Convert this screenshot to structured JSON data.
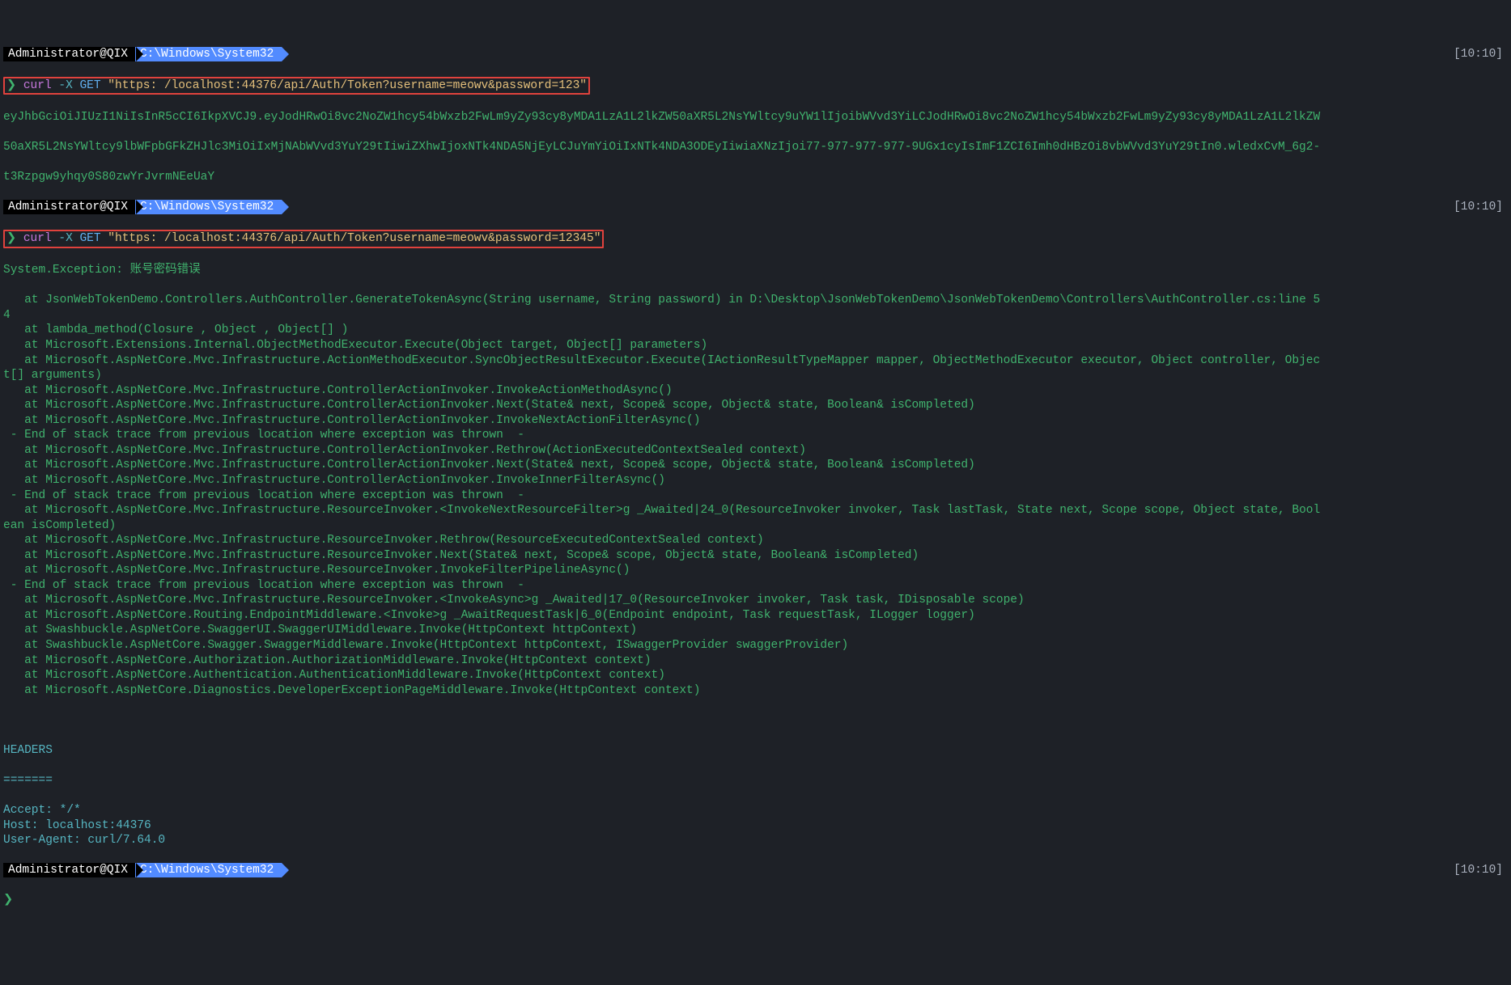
{
  "time": "[10:10]",
  "user": "Administrator@QIX",
  "path": "C:\\Windows\\System32",
  "prompt_sym": "❯",
  "cmd1": {
    "curl": "curl",
    "flag": "-X",
    "method": "GET",
    "url": "\"https: /localhost:44376/api/Auth/Token?username=meowv&password=123\""
  },
  "out1_l1": "eyJhbGciOiJIUzI1NiIsInR5cCI6IkpXVCJ9.eyJodHRwOi8vc2NoZW1hcy54bWxzb2FwLm9yZy93cy8yMDA1LzA1L2lkZW50aXR5L2NsYWltcy9uYW1lIjoibWVvd3YiLCJodHRwOi8vc2NoZW1hcy54bWxzb2FwLm9yZy93cy8yMDA1LzA1L2lkZW",
  "out1_l2": "50aXR5L2NsYWltcy9lbWFpbGFkZHJlc3MiOiIxMjNAbWVvd3YuY29tIiwiZXhwIjoxNTk4NDA5NjEyLCJuYmYiOiIxNTk4NDA3ODEyIiwiaXNzIjoi77-977-977-977-9UGx1cyIsImF1ZCI6Imh0dHBzOi8vbWVvd3YuY29tIn0.wledxCvM_6g2-",
  "out1_l3": "t3Rzpgw9yhqy0S80zwYrJvrmNEeUaY",
  "cmd2": {
    "curl": "curl",
    "flag": "-X",
    "method": "GET",
    "url": "\"https: /localhost:44376/api/Auth/Token?username=meowv&password=12345\""
  },
  "err_header": "System.Exception: 账号密码错误",
  "stack": [
    "   at JsonWebTokenDemo.Controllers.AuthController.GenerateTokenAsync(String username, String password) in D:\\Desktop\\JsonWebTokenDemo\\JsonWebTokenDemo\\Controllers\\AuthController.cs:line 5",
    "4",
    "   at lambda_method(Closure , Object , Object[] )",
    "   at Microsoft.Extensions.Internal.ObjectMethodExecutor.Execute(Object target, Object[] parameters)",
    "   at Microsoft.AspNetCore.Mvc.Infrastructure.ActionMethodExecutor.SyncObjectResultExecutor.Execute(IActionResultTypeMapper mapper, ObjectMethodExecutor executor, Object controller, Objec",
    "t[] arguments)",
    "   at Microsoft.AspNetCore.Mvc.Infrastructure.ControllerActionInvoker.InvokeActionMethodAsync()",
    "   at Microsoft.AspNetCore.Mvc.Infrastructure.ControllerActionInvoker.Next(State& next, Scope& scope, Object& state, Boolean& isCompleted)",
    "   at Microsoft.AspNetCore.Mvc.Infrastructure.ControllerActionInvoker.InvokeNextActionFilterAsync()",
    " - End of stack trace from previous location where exception was thrown  -",
    "   at Microsoft.AspNetCore.Mvc.Infrastructure.ControllerActionInvoker.Rethrow(ActionExecutedContextSealed context)",
    "   at Microsoft.AspNetCore.Mvc.Infrastructure.ControllerActionInvoker.Next(State& next, Scope& scope, Object& state, Boolean& isCompleted)",
    "   at Microsoft.AspNetCore.Mvc.Infrastructure.ControllerActionInvoker.InvokeInnerFilterAsync()",
    " - End of stack trace from previous location where exception was thrown  -",
    "   at Microsoft.AspNetCore.Mvc.Infrastructure.ResourceInvoker.<InvokeNextResourceFilter>g _Awaited|24_0(ResourceInvoker invoker, Task lastTask, State next, Scope scope, Object state, Bool",
    "ean isCompleted)",
    "   at Microsoft.AspNetCore.Mvc.Infrastructure.ResourceInvoker.Rethrow(ResourceExecutedContextSealed context)",
    "   at Microsoft.AspNetCore.Mvc.Infrastructure.ResourceInvoker.Next(State& next, Scope& scope, Object& state, Boolean& isCompleted)",
    "   at Microsoft.AspNetCore.Mvc.Infrastructure.ResourceInvoker.InvokeFilterPipelineAsync()",
    " - End of stack trace from previous location where exception was thrown  -",
    "   at Microsoft.AspNetCore.Mvc.Infrastructure.ResourceInvoker.<InvokeAsync>g _Awaited|17_0(ResourceInvoker invoker, Task task, IDisposable scope)",
    "   at Microsoft.AspNetCore.Routing.EndpointMiddleware.<Invoke>g _AwaitRequestTask|6_0(Endpoint endpoint, Task requestTask, ILogger logger)",
    "   at Swashbuckle.AspNetCore.SwaggerUI.SwaggerUIMiddleware.Invoke(HttpContext httpContext)",
    "   at Swashbuckle.AspNetCore.Swagger.SwaggerMiddleware.Invoke(HttpContext httpContext, ISwaggerProvider swaggerProvider)",
    "   at Microsoft.AspNetCore.Authorization.AuthorizationMiddleware.Invoke(HttpContext context)",
    "   at Microsoft.AspNetCore.Authentication.AuthenticationMiddleware.Invoke(HttpContext context)",
    "   at Microsoft.AspNetCore.Diagnostics.DeveloperExceptionPageMiddleware.Invoke(HttpContext context)"
  ],
  "headers_title": "HEADERS",
  "headers_sep": "=======",
  "headers": [
    "Accept: */*",
    "Host: localhost:44376",
    "User-Agent: curl/7.64.0"
  ]
}
